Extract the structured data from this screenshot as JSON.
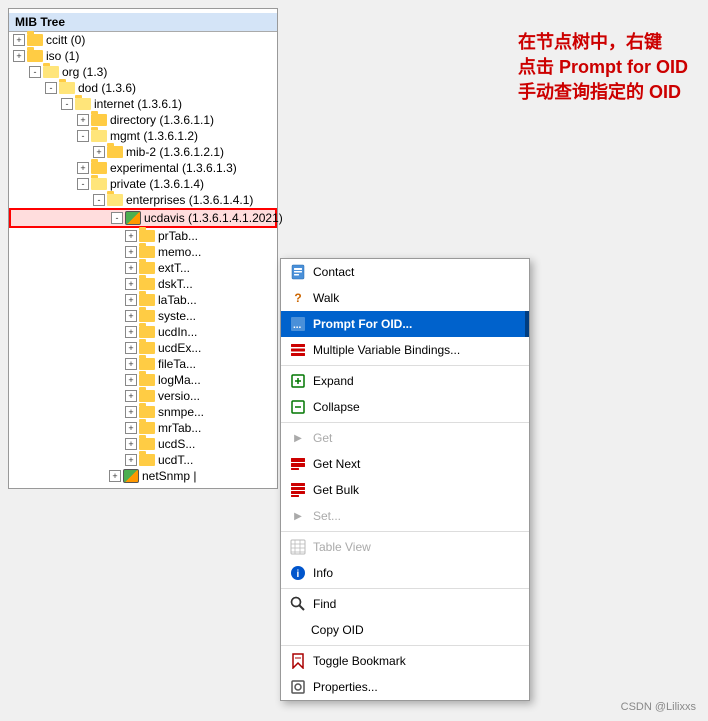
{
  "title": "MIB Tree",
  "annotation": {
    "line1": "在节点树中，右键",
    "line2": "点击 Prompt for OID",
    "line3": "手动查询指定的 OID"
  },
  "tree": {
    "title": "MIB Tree",
    "nodes": [
      {
        "id": "ccitt",
        "label": "ccitt (0)",
        "indent": 1,
        "expand": "+",
        "icon": "folder"
      },
      {
        "id": "iso",
        "label": "iso (1)",
        "indent": 1,
        "expand": "+",
        "icon": "folder"
      },
      {
        "id": "org",
        "label": "org (1.3)",
        "indent": 2,
        "expand": "-",
        "icon": "folder"
      },
      {
        "id": "dod",
        "label": "dod (1.3.6)",
        "indent": 3,
        "expand": "-",
        "icon": "folder"
      },
      {
        "id": "internet",
        "label": "internet (1.3.6.1)",
        "indent": 4,
        "expand": "-",
        "icon": "folder"
      },
      {
        "id": "directory",
        "label": "directory (1.3.6.1.1)",
        "indent": 5,
        "expand": "+",
        "icon": "folder"
      },
      {
        "id": "mgmt",
        "label": "mgmt (1.3.6.1.2)",
        "indent": 5,
        "expand": "-",
        "icon": "folder"
      },
      {
        "id": "mib2",
        "label": "mib-2 (1.3.6.1.2.1)",
        "indent": 6,
        "expand": "+",
        "icon": "folder"
      },
      {
        "id": "experimental",
        "label": "experimental (1.3.6.1.3)",
        "indent": 5,
        "expand": "+",
        "icon": "folder"
      },
      {
        "id": "private",
        "label": "private (1.3.6.1.4)",
        "indent": 5,
        "expand": "-",
        "icon": "folder"
      },
      {
        "id": "enterprises",
        "label": "enterprises (1.3.6.1.4.1)",
        "indent": 6,
        "expand": "-",
        "icon": "folder"
      },
      {
        "id": "ucdavis",
        "label": "ucdavis (1.3.6.1.4.1.2021)",
        "indent": 7,
        "expand": "-",
        "icon": "node-special",
        "selected": true
      },
      {
        "id": "prTab",
        "label": "prTab...",
        "indent": 8,
        "expand": "+",
        "icon": "folder"
      },
      {
        "id": "memo",
        "label": "memo...",
        "indent": 8,
        "expand": "+",
        "icon": "folder"
      },
      {
        "id": "extT",
        "label": "extT...",
        "indent": 8,
        "expand": "+",
        "icon": "folder"
      },
      {
        "id": "dskT",
        "label": "dskT...",
        "indent": 8,
        "expand": "+",
        "icon": "folder"
      },
      {
        "id": "laTab",
        "label": "laTab...",
        "indent": 8,
        "expand": "+",
        "icon": "folder"
      },
      {
        "id": "syste",
        "label": "syste...",
        "indent": 8,
        "expand": "+",
        "icon": "folder"
      },
      {
        "id": "ucdIn",
        "label": "ucdIn...",
        "indent": 8,
        "expand": "+",
        "icon": "folder"
      },
      {
        "id": "ucdEx",
        "label": "ucdEx...",
        "indent": 8,
        "expand": "+",
        "icon": "folder"
      },
      {
        "id": "fileTa",
        "label": "fileTa...",
        "indent": 8,
        "expand": "+",
        "icon": "folder"
      },
      {
        "id": "logMa",
        "label": "logMa...",
        "indent": 8,
        "expand": "+",
        "icon": "folder"
      },
      {
        "id": "versio",
        "label": "versio...",
        "indent": 8,
        "expand": "+",
        "icon": "folder"
      },
      {
        "id": "snmpe",
        "label": "snmpe...",
        "indent": 8,
        "expand": "+",
        "icon": "folder"
      },
      {
        "id": "mrTab",
        "label": "mrTab...",
        "indent": 8,
        "expand": "+",
        "icon": "folder"
      },
      {
        "id": "ucdS",
        "label": "ucdS...",
        "indent": 8,
        "expand": "+",
        "icon": "folder"
      },
      {
        "id": "ucdT",
        "label": "ucdT...",
        "indent": 8,
        "expand": "+",
        "icon": "folder"
      },
      {
        "id": "netSnmp",
        "label": "netSnmp |",
        "indent": 7,
        "expand": "+",
        "icon": "node-special"
      }
    ]
  },
  "contextMenu": {
    "items": [
      {
        "id": "contact",
        "label": "Contact",
        "icon": "contact",
        "disabled": false,
        "separator_before": false
      },
      {
        "id": "walk",
        "label": "Walk",
        "icon": "walk",
        "disabled": false,
        "separator_before": false
      },
      {
        "id": "prompt",
        "label": "Prompt For OID...",
        "icon": "prompt",
        "disabled": false,
        "highlighted": true,
        "separator_before": false
      },
      {
        "id": "multi",
        "label": "Multiple Variable Bindings...",
        "icon": "multi",
        "disabled": false,
        "separator_before": false
      },
      {
        "id": "expand",
        "label": "Expand",
        "icon": "expand",
        "disabled": false,
        "separator_before": true
      },
      {
        "id": "collapse",
        "label": "Collapse",
        "icon": "collapse",
        "disabled": false,
        "separator_before": false
      },
      {
        "id": "get",
        "label": "Get",
        "icon": "get",
        "disabled": true,
        "separator_before": true
      },
      {
        "id": "getnext",
        "label": "Get Next",
        "icon": "getnext",
        "disabled": false,
        "separator_before": false
      },
      {
        "id": "getbulk",
        "label": "Get Bulk",
        "icon": "getbulk",
        "disabled": false,
        "separator_before": false
      },
      {
        "id": "set",
        "label": "Set...",
        "icon": "set",
        "disabled": true,
        "separator_before": false
      },
      {
        "id": "tableview",
        "label": "Table View",
        "icon": "table",
        "disabled": true,
        "separator_before": true
      },
      {
        "id": "info",
        "label": "Info",
        "icon": "info",
        "disabled": false,
        "separator_before": false
      },
      {
        "id": "find",
        "label": "Find",
        "icon": "find",
        "disabled": false,
        "separator_before": true
      },
      {
        "id": "copyoid",
        "label": "Copy OID",
        "icon": "copyoid",
        "disabled": false,
        "separator_before": false
      },
      {
        "id": "bookmark",
        "label": "Toggle Bookmark",
        "icon": "bookmark",
        "disabled": false,
        "separator_before": true
      },
      {
        "id": "props",
        "label": "Properties...",
        "icon": "props",
        "disabled": false,
        "separator_before": false
      }
    ]
  },
  "watermark": "CSDN @Lilixxs"
}
